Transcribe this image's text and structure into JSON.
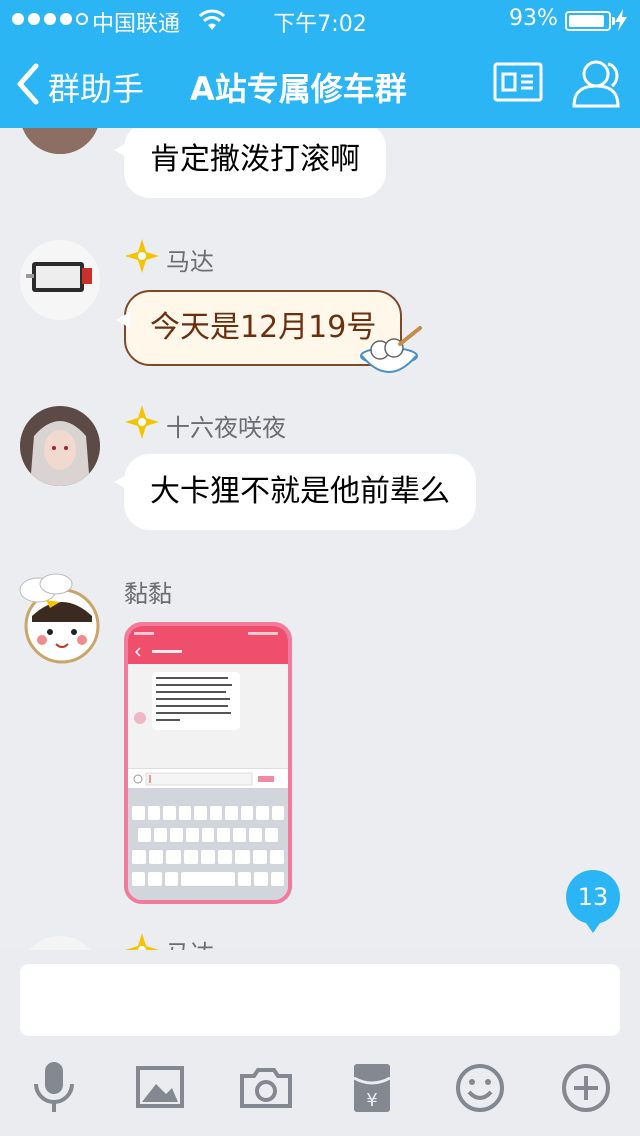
{
  "status_bar": {
    "carrier": "中国联通",
    "time": "下午7:02",
    "battery": "93%",
    "battery_level": 0.93
  },
  "nav": {
    "back_label": "群助手",
    "title": "A站专属修车群"
  },
  "messages": [
    {
      "text": "肯定撒泼打滚啊"
    },
    {
      "sender": "马达",
      "text": "今天是12月19号"
    },
    {
      "sender": "十六夜咲夜",
      "text": "大卡狸不就是他前辈么"
    },
    {
      "sender": "黏黏",
      "type": "image"
    },
    {
      "sender": "马达"
    }
  ],
  "unread_count": "13",
  "toolbar": [
    "microphone-icon",
    "image-icon",
    "camera-icon",
    "red-packet-icon",
    "emoji-icon",
    "plus-icon"
  ],
  "colors": {
    "accent": "#2bb5f5",
    "background": "#ebedf0",
    "bubble": "#ffffff",
    "badge": "#f5c400"
  }
}
